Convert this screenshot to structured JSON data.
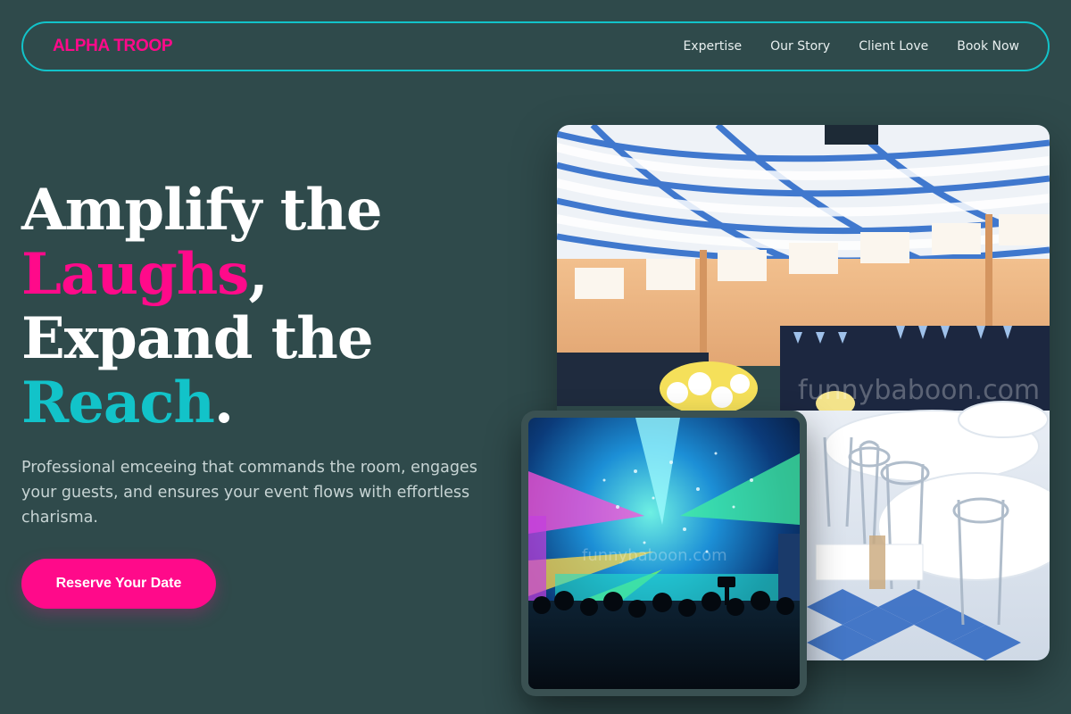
{
  "brand": {
    "name": "ALPHA TROOP",
    "accent_pink": "#ff0a8a",
    "accent_teal": "#12c3c9",
    "background": "#2f4a4b"
  },
  "nav": {
    "links": [
      "Expertise",
      "Our Story",
      "Client Love",
      "Book Now"
    ]
  },
  "hero": {
    "line1": "Amplify the",
    "line2_accent": "Laughs",
    "line2_punct": ",",
    "line3": "Expand the",
    "line4_accent": "Reach",
    "line4_punct": ".",
    "subtext": "Professional emceeing that commands the room, engages your guests, and ensures your event flows with effortless charisma.",
    "cta_label": "Reserve Your Date"
  },
  "images": {
    "main_watermark": "funnybaboon.com",
    "secondary_watermark": "funnybaboon.com"
  }
}
